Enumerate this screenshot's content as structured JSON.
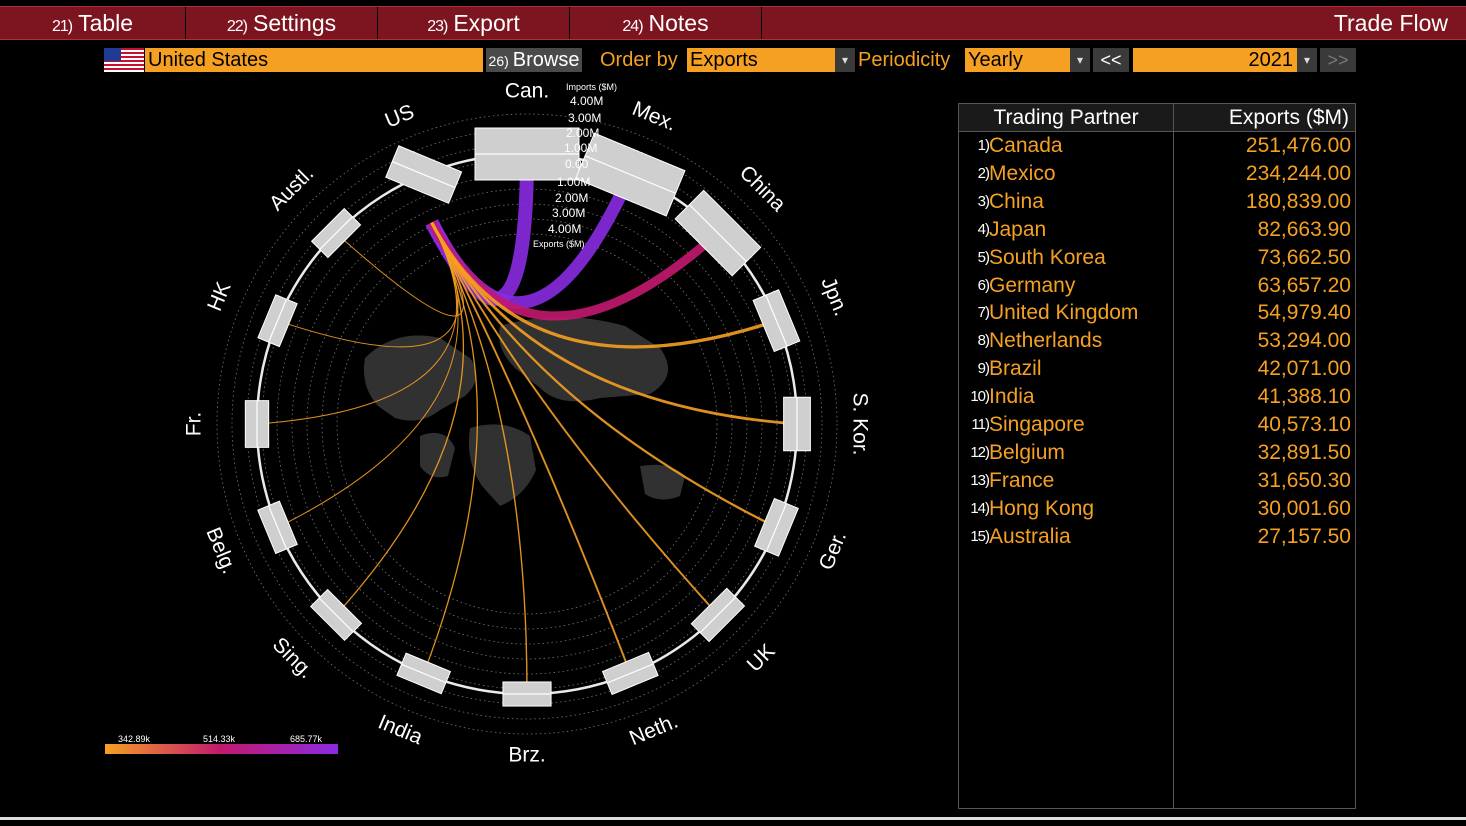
{
  "tabs": [
    {
      "num": "21)",
      "label": "Table"
    },
    {
      "num": "22)",
      "label": "Settings"
    },
    {
      "num": "23)",
      "label": "Export"
    },
    {
      "num": "24)",
      "label": "Notes"
    }
  ],
  "app_title": "Trade Flow",
  "controls": {
    "country": "United States",
    "browse_num": "26)",
    "browse_label": "Browse",
    "order_by_label": "Order by",
    "order_by_value": "Exports",
    "periodicity_label": "Periodicity",
    "periodicity_value": "Yearly",
    "prev_label": "<<",
    "year_value": "2021",
    "next_label": ">>",
    "dropdown_glyph": "▾"
  },
  "chart_data": {
    "type": "chord",
    "center_country": "US",
    "partner_labels": [
      "Can.",
      "Mex.",
      "China",
      "Jpn.",
      "S. Kor.",
      "Ger.",
      "UK",
      "Neth.",
      "Brz.",
      "India",
      "Sing.",
      "Belg.",
      "Fr.",
      "HK",
      "Austl."
    ],
    "upper_axis_title": "Imports ($M)",
    "upper_axis_ticks": [
      "4.00M",
      "3.00M",
      "2.00M",
      "1.00M",
      "0.00"
    ],
    "lower_axis_ticks": [
      "1.00M",
      "2.00M",
      "3.00M",
      "4.00M"
    ],
    "lower_axis_title": "Exports ($M)",
    "flow_values": [
      251476.0,
      234244.0,
      180839.0,
      82663.9,
      73662.5,
      63657.2,
      54979.4,
      53294.0,
      42071.0,
      41388.1,
      40573.1,
      32891.5,
      31650.3,
      30001.6,
      27157.5
    ],
    "legend_ticks": [
      "342.89k",
      "514.33k",
      "685.77k"
    ],
    "legend_colors": [
      "#f5a022",
      "#c2186e",
      "#8a2be2"
    ]
  },
  "table": {
    "headers": [
      "Trading Partner",
      "Exports ($M)"
    ],
    "rows": [
      {
        "rank": "1)",
        "partner": "Canada",
        "value": "251,476.00"
      },
      {
        "rank": "2)",
        "partner": "Mexico",
        "value": "234,244.00"
      },
      {
        "rank": "3)",
        "partner": "China",
        "value": "180,839.00"
      },
      {
        "rank": "4)",
        "partner": "Japan",
        "value": "82,663.90"
      },
      {
        "rank": "5)",
        "partner": "South Korea",
        "value": "73,662.50"
      },
      {
        "rank": "6)",
        "partner": "Germany",
        "value": "63,657.20"
      },
      {
        "rank": "7)",
        "partner": "United Kingdom",
        "value": "54,979.40"
      },
      {
        "rank": "8)",
        "partner": "Netherlands",
        "value": "53,294.00"
      },
      {
        "rank": "9)",
        "partner": "Brazil",
        "value": "42,071.00"
      },
      {
        "rank": "10)",
        "partner": "India",
        "value": "41,388.10"
      },
      {
        "rank": "11)",
        "partner": "Singapore",
        "value": "40,573.10"
      },
      {
        "rank": "12)",
        "partner": "Belgium",
        "value": "32,891.50"
      },
      {
        "rank": "13)",
        "partner": "France",
        "value": "31,650.30"
      },
      {
        "rank": "14)",
        "partner": "Hong Kong",
        "value": "30,001.60"
      },
      {
        "rank": "15)",
        "partner": "Australia",
        "value": "27,157.50"
      }
    ]
  },
  "colors": {
    "tab_bar": "#7d1520",
    "accent_orange": "#f5a022",
    "flow_purple": "#8a2be2",
    "flow_magenta": "#c2186e",
    "node_grey": "#cfcfcf"
  }
}
